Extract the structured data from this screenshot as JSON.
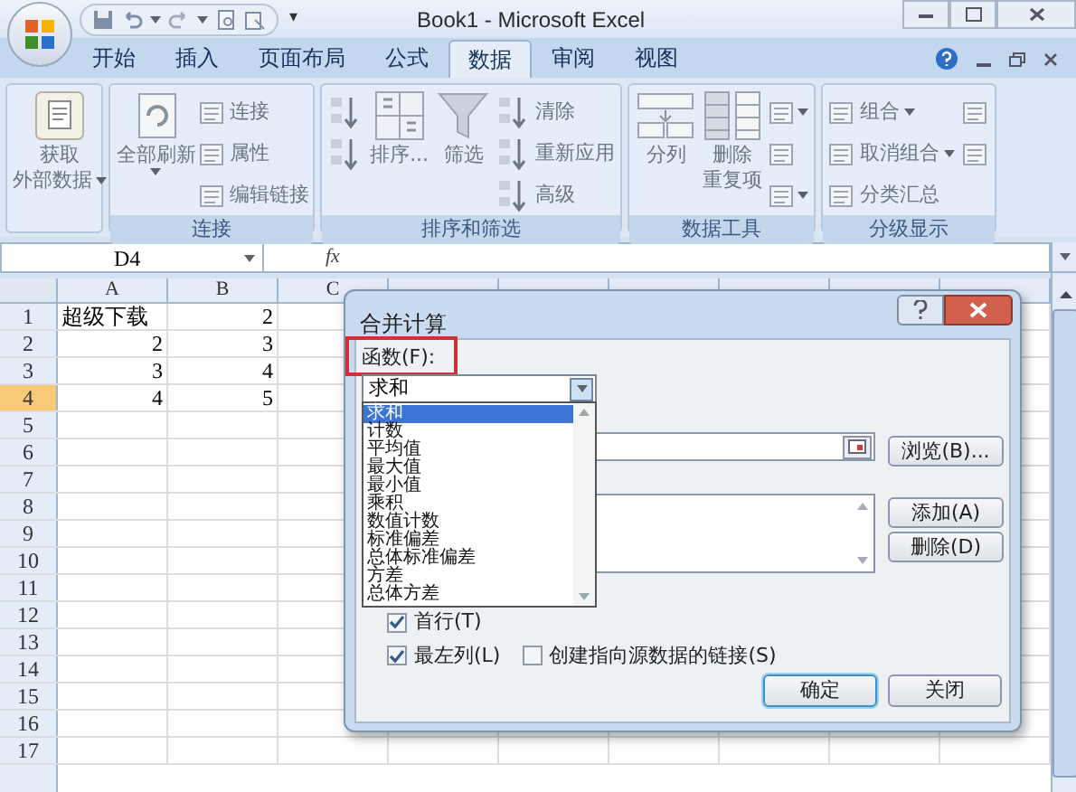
{
  "window": {
    "title": "Book1 - Microsoft Excel",
    "quick_access_more": "▾"
  },
  "tabs": [
    {
      "label": "开始",
      "selected": false
    },
    {
      "label": "插入",
      "selected": false
    },
    {
      "label": "页面布局",
      "selected": false
    },
    {
      "label": "公式",
      "selected": false
    },
    {
      "label": "数据",
      "selected": true
    },
    {
      "label": "审阅",
      "selected": false
    },
    {
      "label": "视图",
      "selected": false
    }
  ],
  "ribbon": {
    "groups": [
      {
        "columns": [
          {
            "kind": "large",
            "lines": [
              "获取",
              "外部数据"
            ],
            "caret": true
          }
        ]
      },
      {
        "label": "连接",
        "columns": [
          {
            "kind": "large",
            "lines": [
              "全部刷新"
            ],
            "caret": true
          },
          {
            "kind": "small",
            "items": [
              {
                "kind": "text",
                "label": "连接",
                "caret": false
              },
              {
                "kind": "text",
                "label": "属性",
                "caret": false
              },
              {
                "kind": "text",
                "label": "编辑链接",
                "caret": false
              }
            ]
          }
        ]
      },
      {
        "label": "排序和筛选",
        "columns": [
          {
            "kind": "small",
            "items": [
              {
                "kind": "icon",
                "caret": false
              },
              {
                "kind": "icon",
                "caret": false
              }
            ]
          },
          {
            "kind": "large",
            "lines": [
              "排序..."
            ],
            "caret": false
          },
          {
            "kind": "large",
            "lines": [
              "筛选"
            ],
            "caret": false
          },
          {
            "kind": "small",
            "items": [
              {
                "kind": "text",
                "label": "清除",
                "caret": false
              },
              {
                "kind": "text",
                "label": "重新应用",
                "caret": false
              },
              {
                "kind": "text",
                "label": "高级",
                "caret": false
              }
            ]
          }
        ]
      },
      {
        "label": "数据工具",
        "columns": [
          {
            "kind": "large",
            "lines": [
              "分列"
            ],
            "caret": false
          },
          {
            "kind": "large",
            "lines": [
              "删除",
              "重复项"
            ],
            "caret": false
          },
          {
            "kind": "small",
            "items": [
              {
                "kind": "icon",
                "caret": true
              },
              {
                "kind": "icon",
                "caret": false
              },
              {
                "kind": "icon",
                "caret": true
              }
            ]
          }
        ]
      },
      {
        "label": "分级显示",
        "columns": [
          {
            "kind": "small",
            "items": [
              {
                "kind": "text",
                "label": "组合",
                "caret": true
              },
              {
                "kind": "text",
                "label": "取消组合",
                "caret": true
              },
              {
                "kind": "text",
                "label": "分类汇总",
                "caret": false
              }
            ]
          },
          {
            "kind": "small",
            "items": [
              {
                "kind": "icon",
                "caret": false
              },
              {
                "kind": "icon",
                "caret": false
              }
            ]
          }
        ]
      }
    ]
  },
  "formula_bar": {
    "name_box": "D4",
    "fx": "fx"
  },
  "sheet": {
    "columns": [
      {
        "label": "A"
      },
      {
        "label": "B"
      },
      {
        "label": "C"
      }
    ],
    "rows": [
      {
        "header": "1",
        "selected": false,
        "cells": [
          {
            "kind": "text",
            "value": "超级下载"
          },
          {
            "kind": "number",
            "value": "2"
          }
        ]
      },
      {
        "header": "2",
        "selected": false,
        "cells": [
          {
            "kind": "number",
            "value": "2"
          },
          {
            "kind": "number",
            "value": "3"
          }
        ]
      },
      {
        "header": "3",
        "selected": false,
        "cells": [
          {
            "kind": "number",
            "value": "3"
          },
          {
            "kind": "number",
            "value": "4"
          }
        ]
      },
      {
        "header": "4",
        "selected": true,
        "cells": [
          {
            "kind": "number",
            "value": "4"
          },
          {
            "kind": "number",
            "value": "5"
          }
        ]
      },
      {
        "header": "5",
        "selected": false,
        "cells": []
      },
      {
        "header": "6",
        "selected": false,
        "cells": []
      },
      {
        "header": "7",
        "selected": false,
        "cells": []
      },
      {
        "header": "8",
        "selected": false,
        "cells": []
      },
      {
        "header": "9",
        "selected": false,
        "cells": []
      },
      {
        "header": "10",
        "selected": false,
        "cells": []
      },
      {
        "header": "11",
        "selected": false,
        "cells": []
      },
      {
        "header": "12",
        "selected": false,
        "cells": []
      },
      {
        "header": "13",
        "selected": false,
        "cells": []
      },
      {
        "header": "14",
        "selected": false,
        "cells": []
      },
      {
        "header": "15",
        "selected": false,
        "cells": []
      },
      {
        "header": "16",
        "selected": false,
        "cells": []
      },
      {
        "header": "17",
        "selected": false,
        "cells": []
      }
    ]
  },
  "dialog": {
    "title": "合并计算",
    "function_label": "函数(F):",
    "function_value": "求和",
    "function_options": [
      {
        "label": "求和",
        "selected": true
      },
      {
        "label": "计数",
        "selected": false
      },
      {
        "label": "平均值",
        "selected": false
      },
      {
        "label": "最大值",
        "selected": false
      },
      {
        "label": "最小值",
        "selected": false
      },
      {
        "label": "乘积",
        "selected": false
      },
      {
        "label": "数值计数",
        "selected": false
      },
      {
        "label": "标准偏差",
        "selected": false
      },
      {
        "label": "总体标准偏差",
        "selected": false
      },
      {
        "label": "方差",
        "selected": false
      },
      {
        "label": "总体方差",
        "selected": false
      }
    ],
    "browse_button": "浏览(B)...",
    "add_button": "添加(A)",
    "delete_button": "删除(D)",
    "checkboxes": [
      {
        "label": "首行(T)",
        "checked": true
      },
      {
        "label": "最左列(L)",
        "checked": true
      },
      {
        "label": "创建指向源数据的链接(S)",
        "checked": false
      }
    ],
    "buttons": [
      {
        "label": "确定",
        "default": true
      },
      {
        "label": "关闭",
        "default": false
      }
    ]
  }
}
